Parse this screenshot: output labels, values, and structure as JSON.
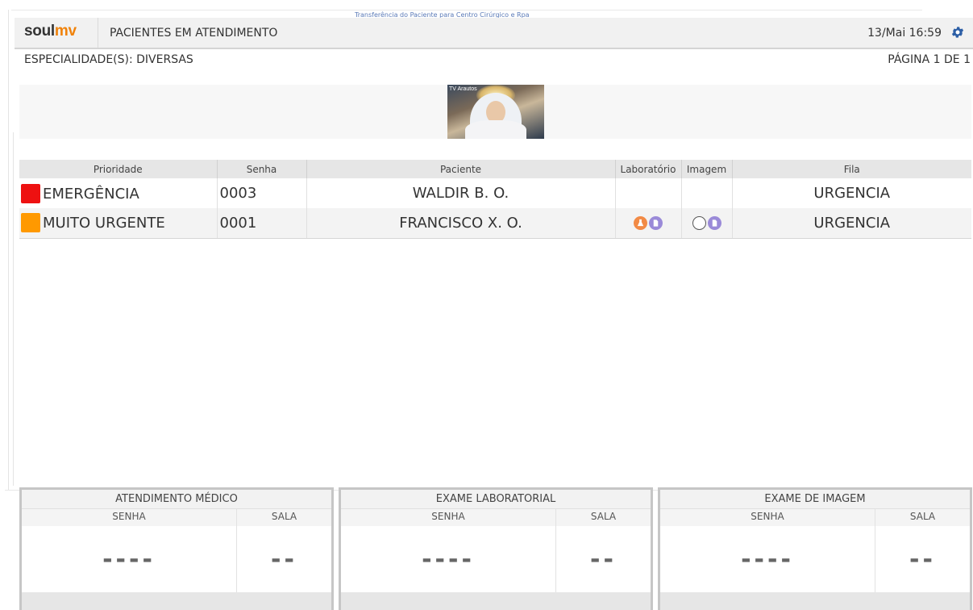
{
  "overlay_title": "Transferência do Paciente para Centro Cirúrgico e Rpa",
  "header": {
    "logo_soul": "soul",
    "logo_mv": "mv",
    "title": "PACIENTES EM ATENDIMENTO",
    "datetime": "13/Mai 16:59",
    "settings_icon": "gear-icon"
  },
  "info": {
    "specialty": "ESPECIALIDADE(S):  DIVERSAS",
    "page": "PÁGINA 1 DE 1"
  },
  "banner": {
    "thumb_label": "TV Arautos"
  },
  "table": {
    "headers": [
      "Prioridade",
      "Senha",
      "Paciente",
      "Laboratório",
      "Imagem",
      "Fila"
    ],
    "rows": [
      {
        "priority": "EMERGÊNCIA",
        "color": "#ee1111",
        "senha": "0003",
        "patient": "WALDIR B. O.",
        "lab_icons": [],
        "img_icons": [],
        "fila": "URGENCIA"
      },
      {
        "priority": "MUITO URGENTE",
        "color": "#ff9900",
        "senha": "0001",
        "patient": "FRANCISCO X. O.",
        "lab_icons": [
          "flask-icon",
          "document-icon"
        ],
        "img_icons": [
          "empty-circle-icon",
          "document-icon"
        ],
        "fila": "URGENCIA"
      }
    ]
  },
  "panels": [
    {
      "title": "ATENDIMENTO MÉDICO",
      "col_senha": "SENHA",
      "col_sala": "SALA",
      "senha": "----",
      "sala": "--"
    },
    {
      "title": "EXAME LABORATORIAL",
      "col_senha": "SENHA",
      "col_sala": "SALA",
      "senha": "----",
      "sala": "--"
    },
    {
      "title": "EXAME DE IMAGEM",
      "col_senha": "SENHA",
      "col_sala": "SALA",
      "senha": "----",
      "sala": "--"
    }
  ]
}
